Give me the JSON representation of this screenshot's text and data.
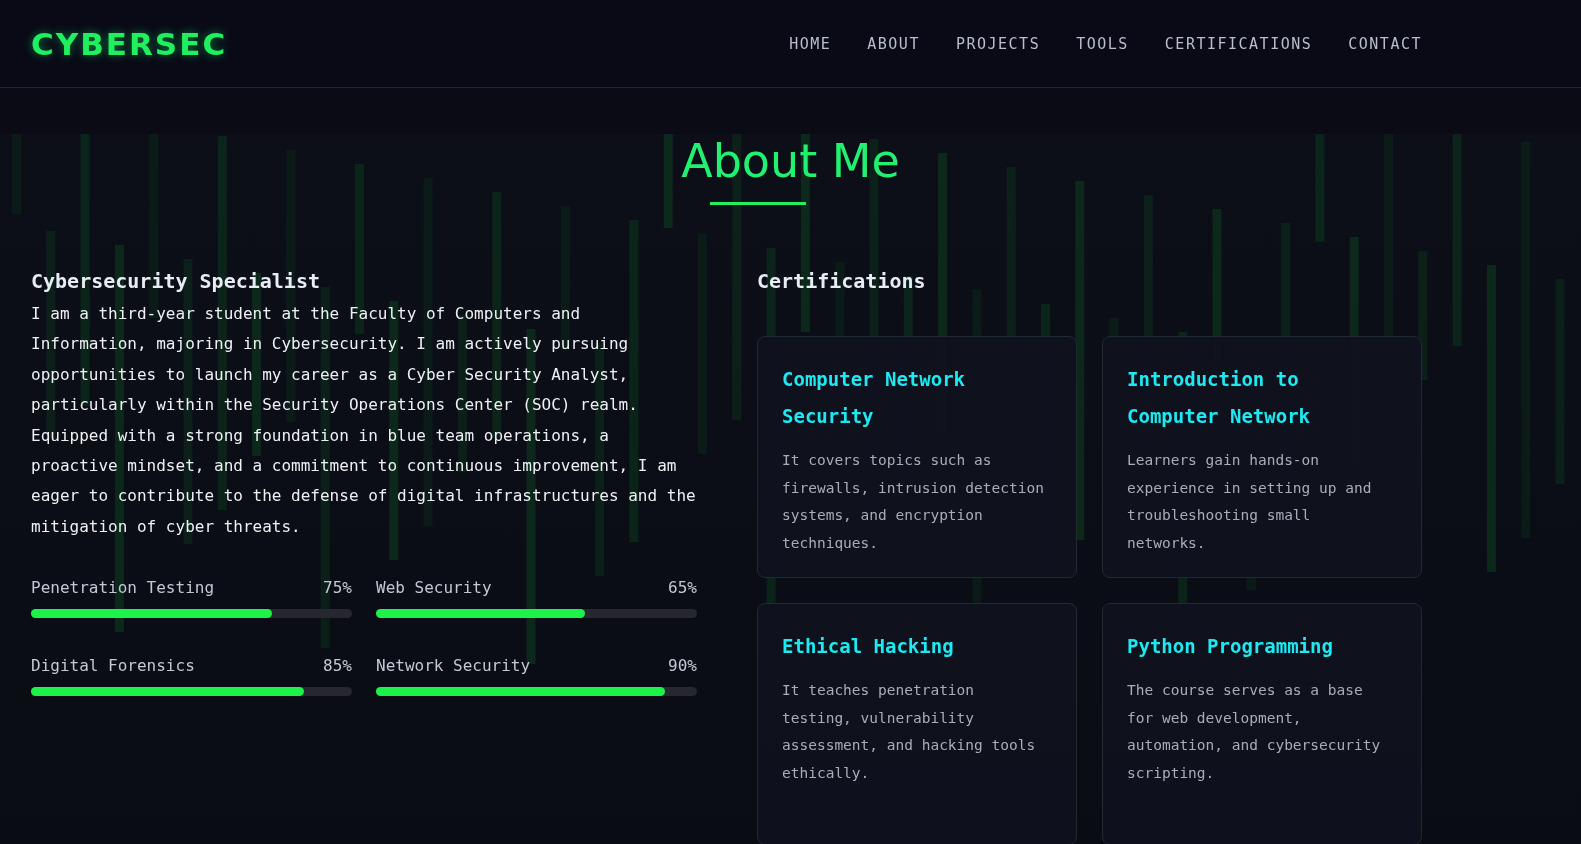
{
  "header": {
    "logo": "CYBERSEC",
    "nav": [
      "HOME",
      "ABOUT",
      "PROJECTS",
      "TOOLS",
      "CERTIFICATIONS",
      "CONTACT"
    ]
  },
  "about": {
    "heading": "About Me",
    "profile": {
      "title": "Cybersecurity Specialist",
      "text": "I am a third-year student at the Faculty of Computers and Information, majoring in Cybersecurity. I am actively pursuing opportunities to launch my career as a Cyber Security Analyst, particularly within the Security Operations Center (SOC) realm. Equipped with a strong foundation in blue team operations, a proactive mindset, and a commitment to continuous improvement, I am eager to contribute to the defense of digital infrastructures and the mitigation of cyber threats."
    },
    "skills": [
      {
        "name": "Penetration Testing",
        "reading": "75%",
        "level": 0.75
      },
      {
        "name": "Web Security",
        "reading": "65%",
        "level": 0.65
      },
      {
        "name": "Digital Forensics",
        "reading": "85%",
        "level": 0.85
      },
      {
        "name": "Network Security",
        "reading": "90%",
        "level": 0.9
      }
    ],
    "certifications": {
      "title": "Certifications",
      "cards": [
        {
          "title": "Computer Network Security",
          "text": "It covers topics such as firewalls, intrusion detection systems, and encryption techniques."
        },
        {
          "title": "Introduction to Computer Network",
          "text": "Learners gain hands-on experience in setting up and troubleshooting small networks."
        },
        {
          "title": "Ethical Hacking",
          "text": "It teaches penetration testing, vulnerability assessment, and hacking tools ethically."
        },
        {
          "title": "Python Programming",
          "text": "The course serves as a base for web development, automation, and cybersecurity scripting."
        }
      ]
    }
  }
}
